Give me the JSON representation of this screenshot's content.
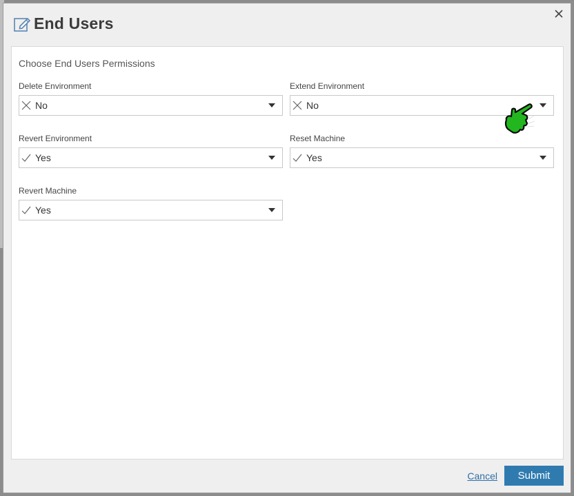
{
  "dialog": {
    "title": "End Users",
    "section_title": "Choose End Users Permissions"
  },
  "fields": [
    {
      "label": "Delete Environment",
      "value": "No",
      "icon": "x-icon"
    },
    {
      "label": "Extend Environment",
      "value": "No",
      "icon": "x-icon"
    },
    {
      "label": "Revert Environment",
      "value": "Yes",
      "icon": "check-icon"
    },
    {
      "label": "Reset Machine",
      "value": "Yes",
      "icon": "check-icon"
    },
    {
      "label": "Revert Machine",
      "value": "Yes",
      "icon": "check-icon"
    }
  ],
  "footer": {
    "cancel_label": "Cancel",
    "submit_label": "Submit"
  },
  "colors": {
    "accent": "#2f7bb0",
    "link": "#2f6fa6",
    "cursor": "#1fb31f"
  },
  "icons": {
    "header": "edit-icon",
    "close": "close-icon",
    "cursor": "hand-pointer-icon"
  }
}
